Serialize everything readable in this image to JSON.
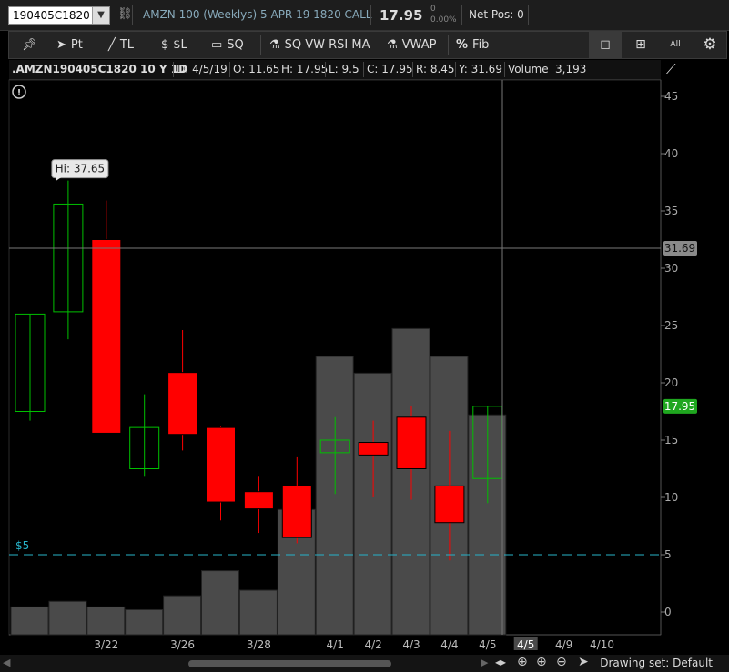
{
  "topbar": {
    "symbol": "190405C1820",
    "description": "AMZN 100 (Weeklys) 5 APR 19 1820 CALL",
    "last_price": "17.95",
    "change": "0",
    "change_pct": "0.00%",
    "net_pos": "Net Pos: 0"
  },
  "toolbar": {
    "pt": "Pt",
    "tl": "TL",
    "sl": "$L",
    "sq": "SQ",
    "studies": "SQ VW RSI MA",
    "vwap": "VWAP",
    "fib": "Fib",
    "all": "All"
  },
  "info": {
    "symbol_period": ".AMZN190405C1820 10 Y 1D",
    "date": "D: 4/5/19",
    "open": "O: 11.65",
    "high": "H: 17.95",
    "low": "L: 9.5",
    "close": "C: 17.95",
    "range": "R: 8.45",
    "y": "Y: 31.69",
    "volume_label": "Volume",
    "volume": "3,193"
  },
  "colors": {
    "up": "#00c000",
    "down": "#ff0000",
    "volume": "#4a4a4a",
    "level_line": "#27b3c9",
    "price_tag": "#1fa61f"
  },
  "chart_data": {
    "type": "candlestick",
    "ylim": [
      -2,
      46
    ],
    "yticks": [
      0,
      5,
      10,
      15,
      20,
      25,
      30,
      35,
      40,
      45
    ],
    "xtick_labels": [
      "3/22",
      "3/26",
      "3/28",
      "4/1",
      "4/2",
      "4/3",
      "4/4",
      "4/5",
      "4/5",
      "4/9",
      "4/10"
    ],
    "candles": [
      {
        "open": 17.5,
        "high": 26.0,
        "low": 16.7,
        "close": 26.0
      },
      {
        "open": 26.2,
        "high": 37.65,
        "low": 23.8,
        "close": 35.6
      },
      {
        "open": 32.5,
        "high": 35.9,
        "low": 15.6,
        "close": 15.6
      },
      {
        "open": 12.5,
        "high": 19.0,
        "low": 11.8,
        "close": 16.1
      },
      {
        "open": 20.9,
        "high": 24.6,
        "low": 14.1,
        "close": 15.5
      },
      {
        "open": 16.1,
        "high": 16.2,
        "low": 8.0,
        "close": 9.6
      },
      {
        "open": 10.5,
        "high": 11.8,
        "low": 6.9,
        "close": 9.0
      },
      {
        "open": 11.0,
        "high": 13.5,
        "low": 6.0,
        "close": 6.5
      },
      {
        "open": 13.9,
        "high": 17.0,
        "low": 10.3,
        "close": 15.0
      },
      {
        "open": 14.8,
        "high": 16.7,
        "low": 10.0,
        "close": 13.7
      },
      {
        "open": 17.0,
        "high": 18.0,
        "low": 9.8,
        "close": 12.5
      },
      {
        "open": 11.0,
        "high": 15.8,
        "low": 4.5,
        "close": 7.8
      },
      {
        "open": 11.65,
        "high": 17.95,
        "low": 9.5,
        "close": 17.95
      }
    ],
    "volume_relative": [
      0.1,
      0.12,
      0.1,
      0.09,
      0.14,
      0.23,
      0.16,
      0.45,
      1.0,
      0.94,
      1.1,
      1.0,
      0.79
    ],
    "annotations": {
      "high_label": "Hi: 37.65",
      "crosshair_value": "31.69",
      "last_value": "17.95",
      "level_value": 5,
      "level_label": "$5"
    }
  },
  "bottom": {
    "drawing_set": "Drawing set: Default"
  }
}
